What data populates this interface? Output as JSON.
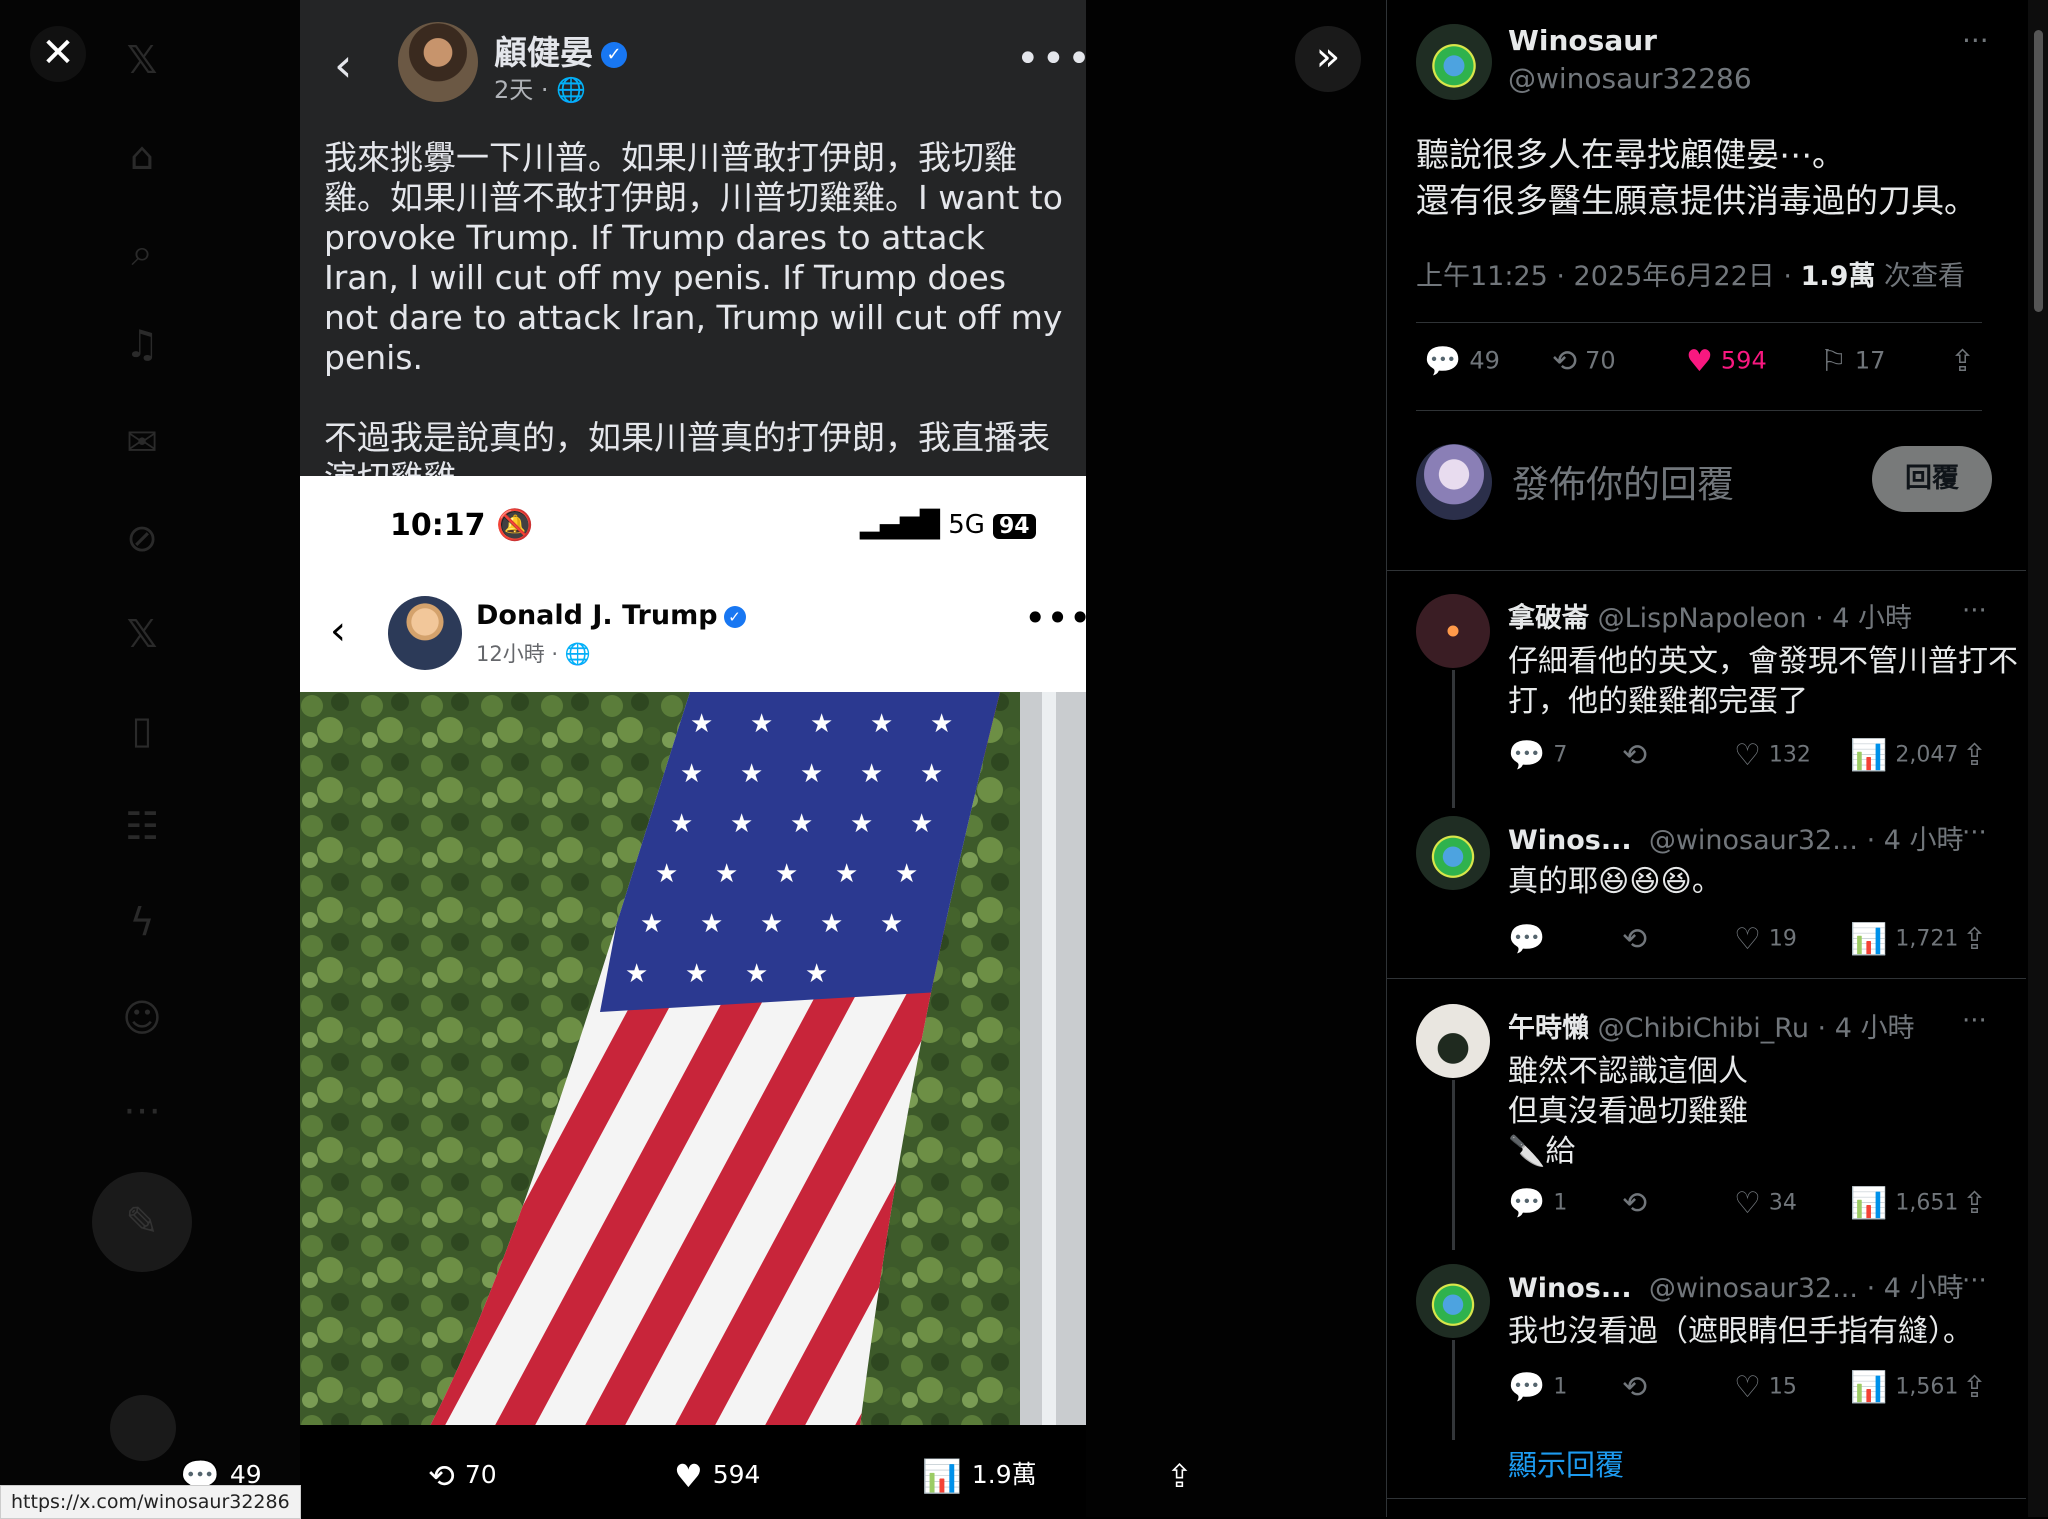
{
  "viewer": {
    "close_icon": "close-icon",
    "next_icon": "double-chevron-right-icon",
    "url_tooltip": "https://x.com/winosaur32286"
  },
  "media": {
    "fb_post": {
      "author": "顧健晏",
      "time": "2天 · ",
      "text": "我來挑釁一下川普。如果川普敢打伊朗，我切雞雞。如果川普不敢打伊朗，川普切雞雞。I want to provoke Trump. If Trump dares to attack Iran, I will cut off my penis. If Trump does not dare to attack Iran, Trump will cut off my penis.\n\n不過我是說真的，如果川普真的打伊朗，我直播表演切雞雞。",
      "embedded": {
        "phone_time": "10:17",
        "network": "5G",
        "battery": "94",
        "author": "Donald J. Trump",
        "time": "12小時 · "
      }
    }
  },
  "bottom_bar": {
    "replies": "49",
    "reposts": "70",
    "likes": "594",
    "views": "1.9萬"
  },
  "tweet": {
    "display_name": "Winosaur",
    "handle": "@winosaur32286",
    "text_line1": "聽說很多人在尋找顧健晏⋯。",
    "text_line2": "還有很多醫生願意提供消毒過的刀具。",
    "timestamp": "上午11:25 · 2025年6月22日 · ",
    "views_count": "1.9萬",
    "views_label": " 次查看",
    "replies": "49",
    "reposts": "70",
    "likes": "594",
    "bookmarks": "17",
    "like_color": "#f91880"
  },
  "composer": {
    "placeholder": "發佈你的回覆",
    "reply_button": "回覆"
  },
  "replies": [
    {
      "name": "拿破崙",
      "handle": "@LispNapoleon",
      "time": " · 4 小時",
      "lines": [
        "仔細看他的英文，會發現不管川普打不",
        "打，他的雞雞都完蛋了"
      ],
      "comments": "7",
      "likes": "132",
      "views": "2,047"
    },
    {
      "name": "Winos...",
      "handle": "@winosaur32...",
      "time": " · 4 小時",
      "lines": [
        "真的耶😆😆😆。"
      ],
      "comments": "",
      "likes": "19",
      "views": "1,721"
    },
    {
      "name": "午時懶",
      "handle": "@ChibiChibi_Ru",
      "time": " · 4 小時",
      "lines": [
        "雖然不認識這個人",
        "但真沒看過切雞雞",
        "🔪給"
      ],
      "comments": "1",
      "likes": "34",
      "views": "1,651"
    },
    {
      "name": "Winos...",
      "handle": "@winosaur32...",
      "time": " · 4 小時",
      "lines": [
        "我也沒看過（遮眼睛但手指有縫）。"
      ],
      "comments": "1",
      "likes": "15",
      "views": "1,561"
    }
  ],
  "show_replies": "顯示回覆",
  "colors": {
    "accent": "#1d9bf0",
    "fb_bg": "#242526",
    "panel_border": "#2f3336"
  }
}
